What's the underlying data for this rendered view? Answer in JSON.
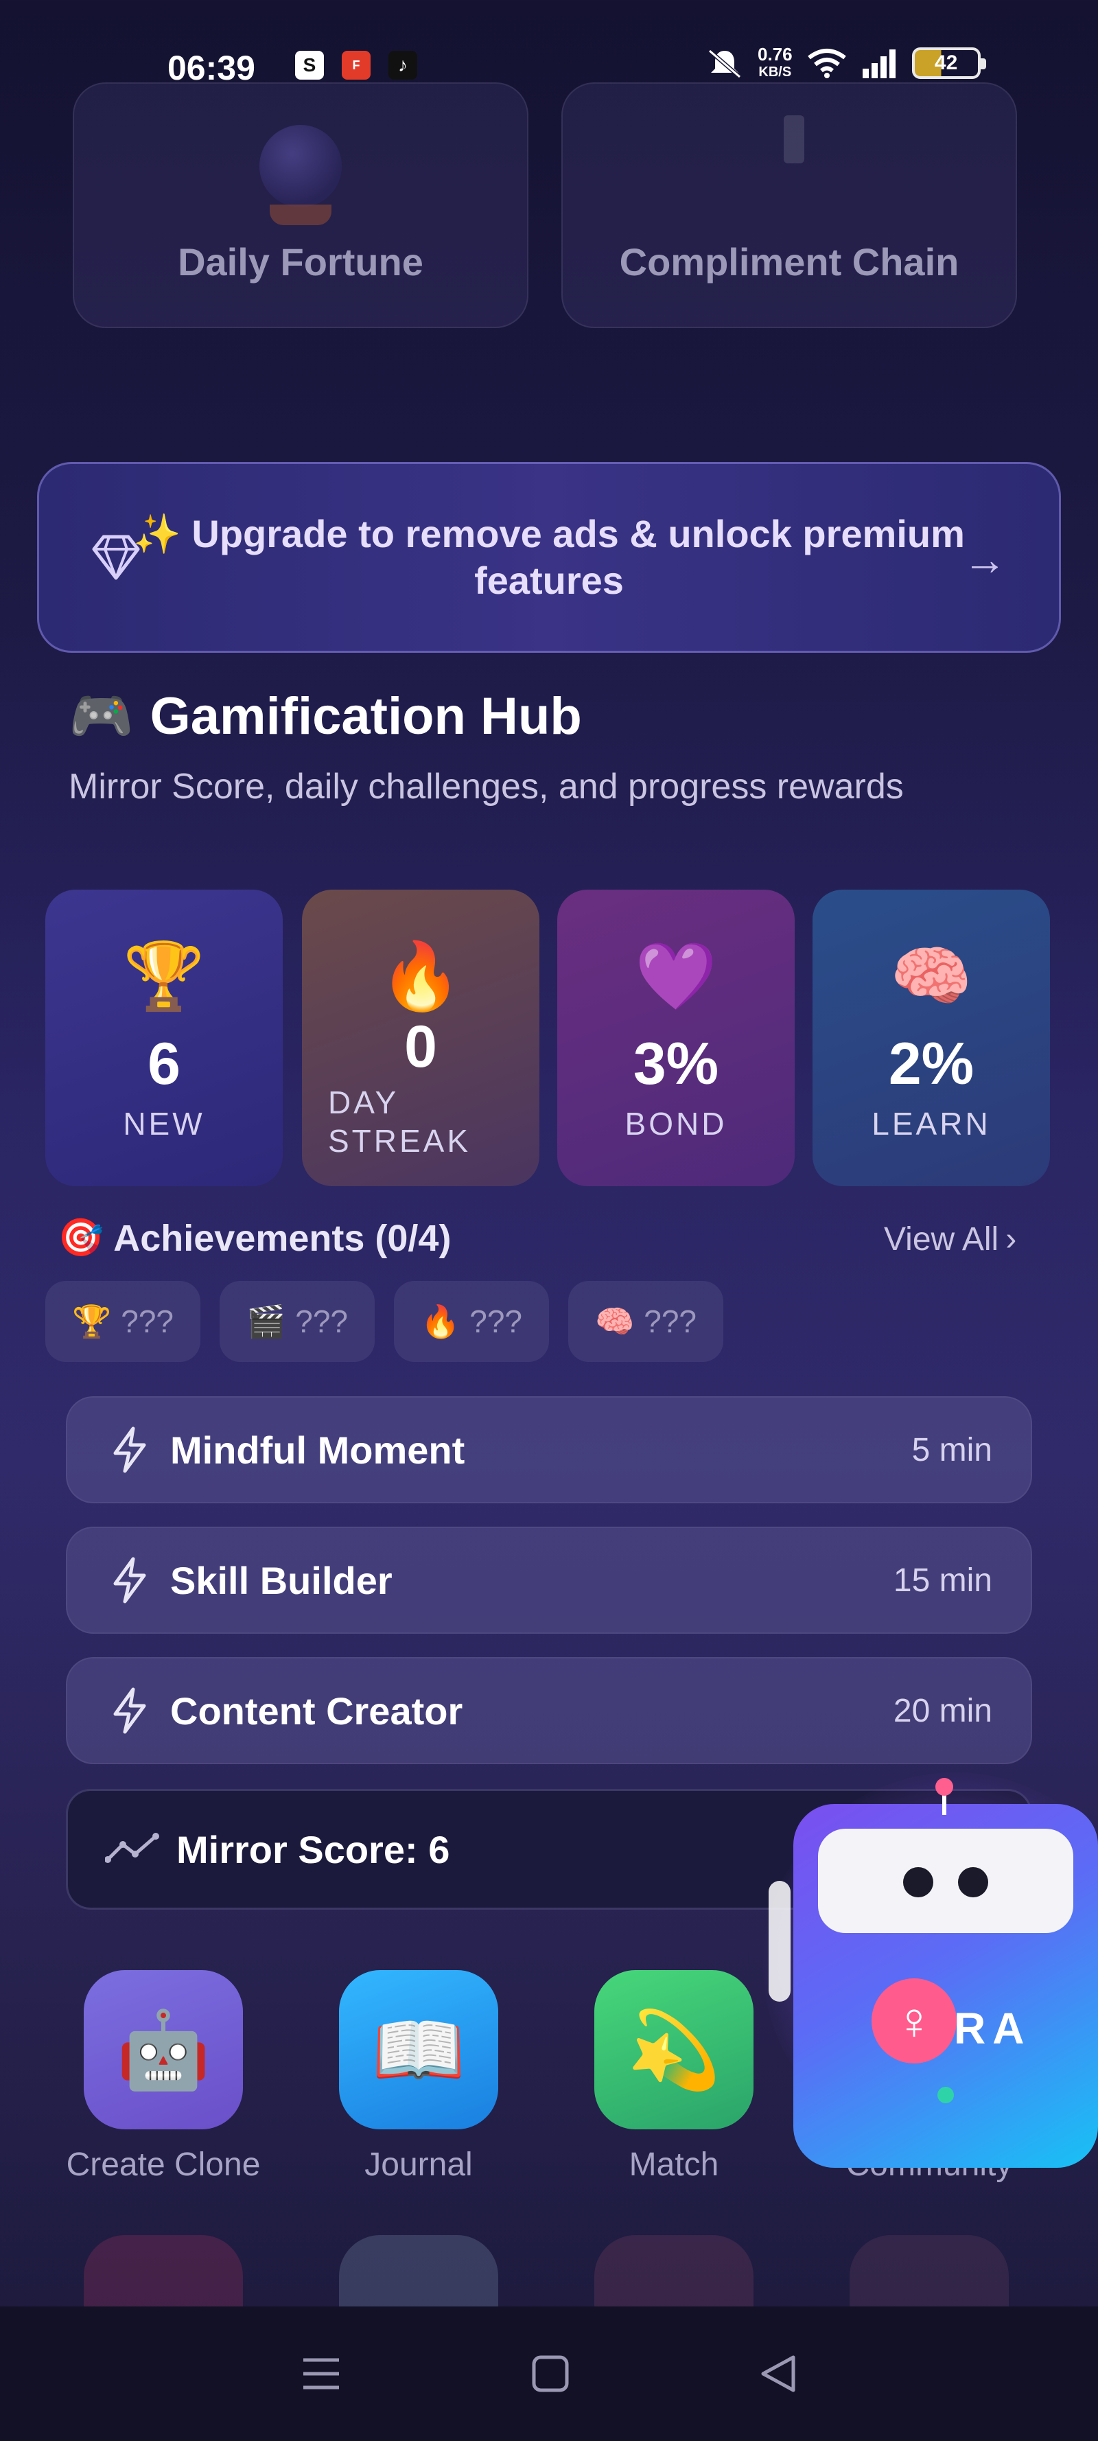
{
  "status_bar": {
    "time": "06:39",
    "notification_icons": [
      "shopee-icon",
      "fpay-icon",
      "tiktok-icon"
    ],
    "net_speed_value": "0.76",
    "net_speed_unit": "KB/S",
    "battery": "42"
  },
  "top_cards": [
    {
      "label": "Daily Fortune",
      "icon": "crystal-ball-icon"
    },
    {
      "label": "Compliment Chain",
      "icon": "chain-icon"
    }
  ],
  "upgrade_banner": {
    "text": "✨ Upgrade to remove ads & unlock premium features"
  },
  "hub": {
    "icon": "🎮",
    "title": "Gamification Hub",
    "subtitle": "Mirror Score, daily challenges, and progress rewards"
  },
  "stats": [
    {
      "emoji": "🏆",
      "value": "6",
      "label": "NEW"
    },
    {
      "emoji": "🔥",
      "value": "0",
      "label": "DAY STREAK"
    },
    {
      "emoji": "💜",
      "value": "3%",
      "label": "BOND"
    },
    {
      "emoji": "🧠",
      "value": "2%",
      "label": "LEARN"
    }
  ],
  "achievements": {
    "icon": "🎯",
    "title": "Achievements (0/4)",
    "view_all": "View All",
    "badges": [
      {
        "emoji": "🏆",
        "text": "???"
      },
      {
        "emoji": "🎬",
        "text": "???"
      },
      {
        "emoji": "🔥",
        "text": "???"
      },
      {
        "emoji": "🧠",
        "text": "???"
      }
    ]
  },
  "challenges": [
    {
      "name": "Mindful Moment",
      "time": "5 min"
    },
    {
      "name": "Skill Builder",
      "time": "15 min"
    },
    {
      "name": "Content Creator",
      "time": "20 min"
    }
  ],
  "mirror_score": {
    "label": "Mirror Score: 6"
  },
  "apps": [
    {
      "emoji": "🤖",
      "label": "Create Clone"
    },
    {
      "emoji": "📖",
      "label": "Journal"
    },
    {
      "emoji": "💫",
      "label": "Match"
    },
    {
      "emoji": "",
      "label": "Community"
    }
  ],
  "ai_widget": {
    "text": "RA",
    "gender_symbol": "♀"
  },
  "colors": {
    "accent": "#7a4ff0",
    "banner_border": "#8c82dc",
    "robot_pink": "#ff5b8d"
  }
}
